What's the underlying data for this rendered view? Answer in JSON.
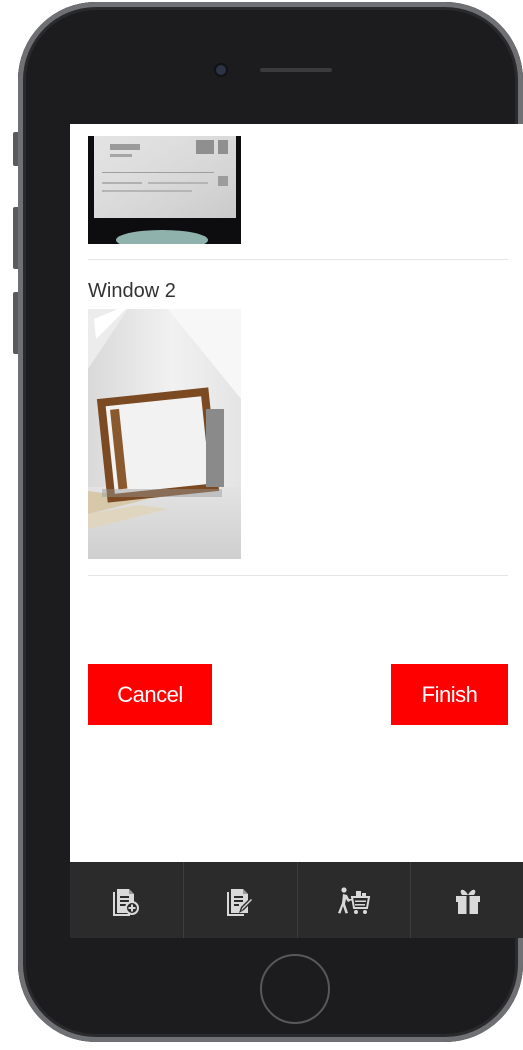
{
  "photos": [
    {
      "label": "",
      "icon": "document-photo"
    },
    {
      "label": "Window 2",
      "icon": "window-frame-photo"
    }
  ],
  "actions": {
    "cancel_label": "Cancel",
    "finish_label": "Finish"
  },
  "tabbar": {
    "items": [
      {
        "icon": "add-document-icon"
      },
      {
        "icon": "edit-document-icon"
      },
      {
        "icon": "shopping-cart-icon"
      },
      {
        "icon": "gift-icon"
      }
    ]
  },
  "colors": {
    "accent": "#ff0000",
    "tabbar_bg": "#2b2b2b",
    "tab_icon": "#d9d9d9"
  }
}
